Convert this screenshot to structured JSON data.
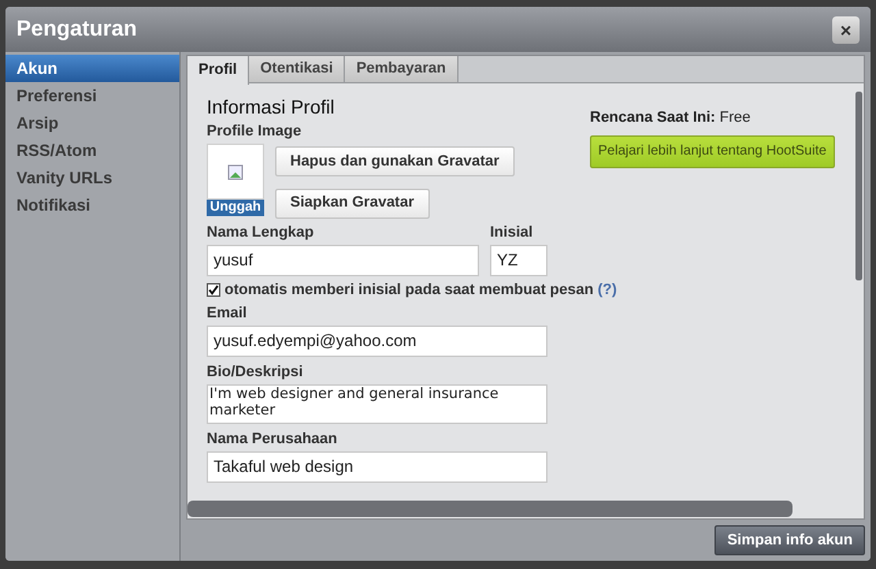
{
  "window": {
    "title": "Pengaturan",
    "close": "×"
  },
  "sidebar": {
    "items": [
      {
        "label": "Akun",
        "selected": true
      },
      {
        "label": "Preferensi",
        "selected": false
      },
      {
        "label": "Arsip",
        "selected": false
      },
      {
        "label": "RSS/Atom",
        "selected": false
      },
      {
        "label": "Vanity URLs",
        "selected": false
      },
      {
        "label": "Notifikasi",
        "selected": false
      }
    ]
  },
  "tabs": [
    {
      "label": "Profil",
      "selected": true
    },
    {
      "label": "Otentikasi",
      "selected": false
    },
    {
      "label": "Pembayaran",
      "selected": false
    }
  ],
  "profile": {
    "heading": "Informasi Profil",
    "image_label": "Profile Image",
    "upload": "Unggah",
    "buttons": [
      "Hapus dan gunakan Gravatar",
      "Siapkan Gravatar"
    ],
    "full_name": {
      "label": "Nama Lengkap",
      "value": "yusuf"
    },
    "initials": {
      "label": "Inisial",
      "value": "YZ"
    },
    "auto_initials": {
      "label": "otomatis memberi inisial pada saat membuat pesan",
      "help": "(?)",
      "checked": true
    },
    "email": {
      "label": "Email",
      "value": "yusuf.edyempi@yahoo.com"
    },
    "bio": {
      "label": "Bio/Deskripsi",
      "value": "I'm web designer and general insurance marketer"
    },
    "company": {
      "label": "Nama Perusahaan",
      "value": "Takaful web design"
    }
  },
  "plan": {
    "label": "Rencana Saat Ini:",
    "value": "Free",
    "button": "Pelajari lebih lanjut tentang HootSuite"
  },
  "footer": {
    "button": "Simpan info akun"
  }
}
